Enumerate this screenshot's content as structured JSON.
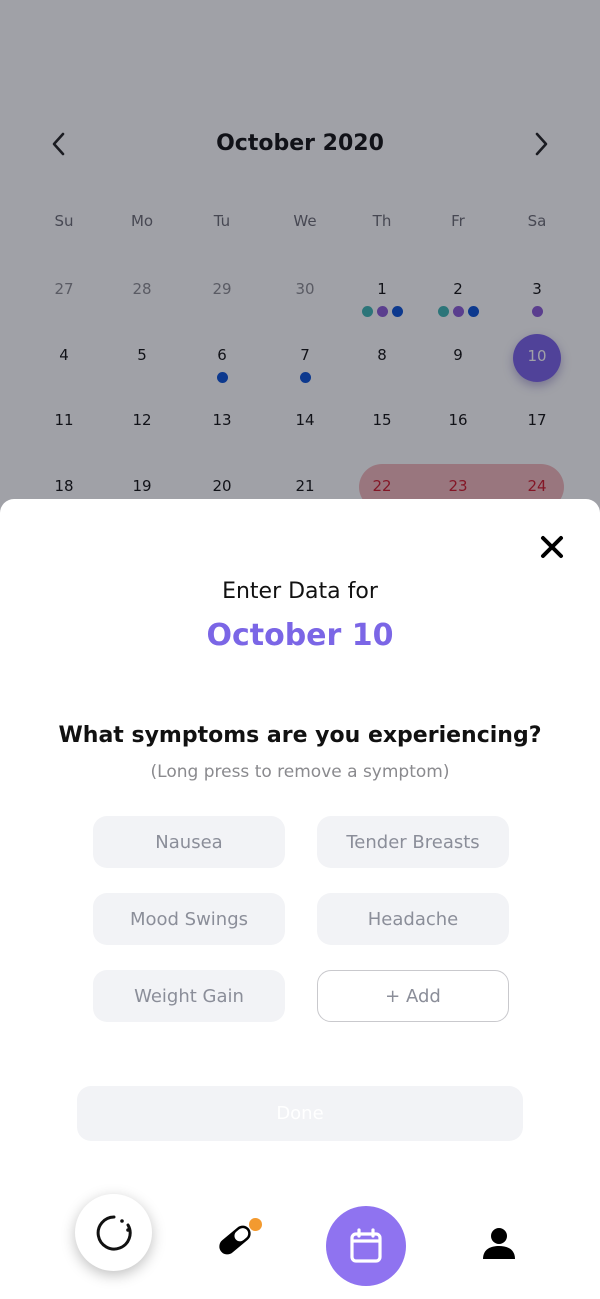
{
  "calendar": {
    "month_title": "October 2020",
    "weekdays": [
      "Su",
      "Mo",
      "Tu",
      "We",
      "Th",
      "Fr",
      "Sa"
    ],
    "weeks": [
      [
        {
          "day": "27",
          "other": true
        },
        {
          "day": "28",
          "other": true
        },
        {
          "day": "29",
          "other": true
        },
        {
          "day": "30",
          "other": true
        },
        {
          "day": "1",
          "dots": [
            "#3fb6b2",
            "#8a5bd6",
            "#0b52d6"
          ]
        },
        {
          "day": "2",
          "dots": [
            "#3fb6b2",
            "#8a5bd6",
            "#0b52d6"
          ]
        },
        {
          "day": "3",
          "dots": [
            "#8a5bd6"
          ]
        }
      ],
      [
        {
          "day": "4"
        },
        {
          "day": "5"
        },
        {
          "day": "6",
          "dots": [
            "#0b52d6"
          ]
        },
        {
          "day": "7",
          "dots": [
            "#0b52d6"
          ]
        },
        {
          "day": "8"
        },
        {
          "day": "9"
        },
        {
          "day": "10",
          "selected": true
        }
      ],
      [
        {
          "day": "11"
        },
        {
          "day": "12"
        },
        {
          "day": "13"
        },
        {
          "day": "14"
        },
        {
          "day": "15"
        },
        {
          "day": "16"
        },
        {
          "day": "17"
        }
      ],
      [
        {
          "day": "18"
        },
        {
          "day": "19"
        },
        {
          "day": "20"
        },
        {
          "day": "21"
        },
        {
          "day": "22",
          "period": true
        },
        {
          "day": "23",
          "period": true
        },
        {
          "day": "24",
          "period": true
        }
      ]
    ]
  },
  "sheet": {
    "title": "Enter Data for",
    "date": "October 10",
    "question": "What symptoms are you experiencing?",
    "hint": "(Long press to remove a symptom)",
    "symptoms": [
      "Nausea",
      "Tender Breasts",
      "Mood Swings",
      "Headache",
      "Weight Gain"
    ],
    "add_label": "+ Add",
    "done_label": "Done"
  },
  "colors": {
    "accent": "#7b66e6",
    "selected_day": "#7b61e8",
    "period_band": "#f3b8bb",
    "period_text": "#d11a2a",
    "pill_badge": "#f39a2f"
  },
  "icons": {
    "prev": "chevron-left-icon",
    "next": "chevron-right-icon",
    "close": "close-icon",
    "tabs": [
      "cycle-icon",
      "pill-icon",
      "calendar-icon",
      "profile-icon"
    ]
  }
}
